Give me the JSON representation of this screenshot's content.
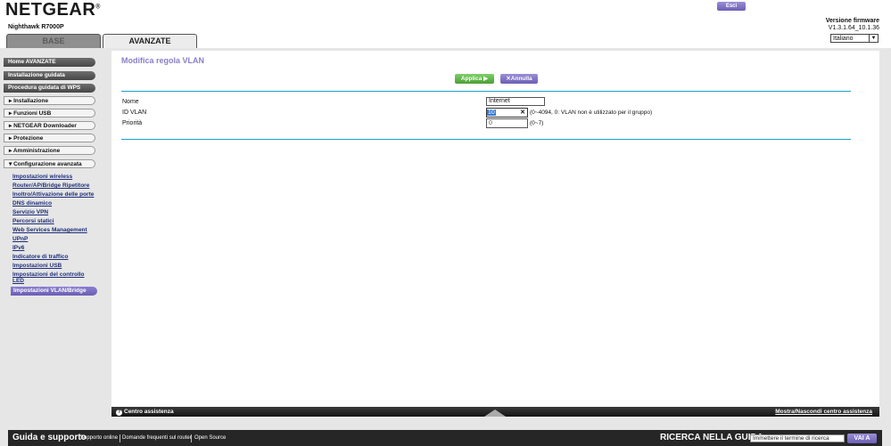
{
  "header": {
    "logo": "NETGEAR",
    "logo_mark": "®",
    "model": "Nighthawk R7000P",
    "tabs": [
      {
        "label": "BASE",
        "active": false
      },
      {
        "label": "AVANZATE",
        "active": true
      }
    ],
    "logout_label": "Esci",
    "firmware_label": "Versione firmware",
    "firmware_version": "V1.3.1.64_10.1.36",
    "language": "Italiano"
  },
  "sidebar": {
    "main_items": [
      {
        "label": "Home AVANZATE"
      },
      {
        "label": "Installazione guidata"
      },
      {
        "label": "Procedura guidata di WPS"
      }
    ],
    "sections": [
      {
        "label": "Installazione",
        "expanded": false
      },
      {
        "label": "Funzioni USB",
        "expanded": false
      },
      {
        "label": "NETGEAR Downloader",
        "expanded": false
      },
      {
        "label": "Protezione",
        "expanded": false
      },
      {
        "label": "Amministrazione",
        "expanded": false
      },
      {
        "label": "Configurazione avanzata",
        "expanded": true
      }
    ],
    "sub_items": [
      {
        "label": "Impostazioni wireless"
      },
      {
        "label": "Router/AP/Bridge Ripetitore"
      },
      {
        "label": "Inoltro/Attivazione delle porte"
      },
      {
        "label": "DNS dinamico"
      },
      {
        "label": "Servizio VPN"
      },
      {
        "label": "Percorsi statici"
      },
      {
        "label": "Web Services Management"
      },
      {
        "label": "UPnP"
      },
      {
        "label": "IPv6"
      },
      {
        "label": "Indicatore di traffico"
      },
      {
        "label": "Impostazioni USB"
      },
      {
        "label": "Impostazioni del controllo",
        "label2": "LED"
      },
      {
        "label": "Impostazioni VLAN/Bridge",
        "active": true
      }
    ]
  },
  "main": {
    "title": "Modifica regola VLAN",
    "apply_label": "Applica",
    "apply_icon": "▶",
    "cancel_label": "Annulla",
    "cancel_icon": "✕",
    "fields": {
      "name_label": "Nome",
      "name_value": "Internet",
      "vlan_label": "ID VLAN",
      "vlan_value": "10",
      "vlan_hint": "(0~4094, 0: VLAN non è utilizzato per il gruppo)",
      "priority_label": "Priorità",
      "priority_value": "0",
      "priority_hint": "(0~7)"
    }
  },
  "help_bar": {
    "label": "Centro assistenza",
    "icon": "?",
    "toggle_label": "Mostra/Nascondi centro assistenza"
  },
  "footer": {
    "title": "Guida e supporto",
    "links": [
      "Supporto online",
      "Domande frequenti sul router",
      "Open Source"
    ],
    "search_label": "RICERCA NELLA GUIDA",
    "search_placeholder": "Immettere il termine di ricerca",
    "search_button": "VAI A"
  }
}
